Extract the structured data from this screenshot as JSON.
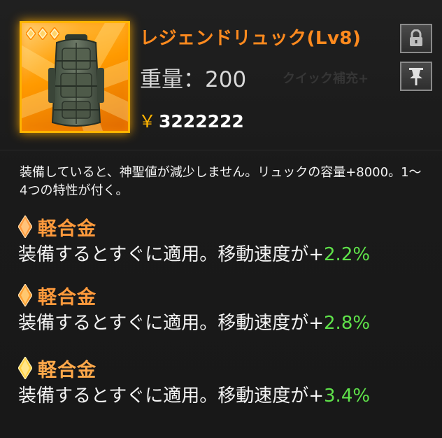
{
  "item": {
    "title": "レジェンドリュック(Lv8)",
    "weight": "重量：200",
    "weight_ghost": "クイック補充+",
    "price_symbol": "￥",
    "price": "3222222",
    "stars": 3,
    "description": "装備していると、神聖値が減少しません。リュックの容量+8000。1～4つの特性が付く。"
  },
  "buttons": {
    "lock_icon": "lock-icon",
    "pin_icon": "pin-icon"
  },
  "traits": [
    {
      "name": "軽合金",
      "text": "装備するとすぐに適用。移動速度が+",
      "value": "2.2%",
      "gem_color": "#ff9a3c"
    },
    {
      "name": "軽合金",
      "text": "装備するとすぐに適用。移動速度が+",
      "value": "2.8%",
      "gem_color": "#ffa030"
    },
    {
      "name": "軽合金",
      "text": "装備するとすぐに適用。移動速度が+",
      "value": "3.4%",
      "gem_color": "#ffd040"
    }
  ],
  "colors": {
    "title": "#ff8a1e",
    "value": "#5fe24a",
    "frame": "#ffb400"
  }
}
